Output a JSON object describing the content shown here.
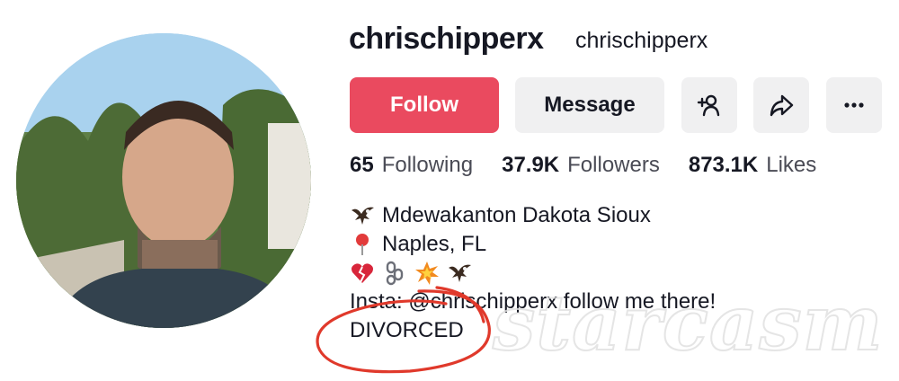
{
  "profile": {
    "username": "chrischipperx",
    "nickname": "chrischipperx"
  },
  "actions": {
    "follow_label": "Follow",
    "message_label": "Message",
    "add_friend_icon": "add-user-icon",
    "share_icon": "share-icon",
    "more_icon": "more-icon"
  },
  "stats": [
    {
      "value": "65",
      "label": "Following"
    },
    {
      "value": "37.9K",
      "label": "Followers"
    },
    {
      "value": "873.1K",
      "label": "Likes"
    }
  ],
  "bio": {
    "line1": "Mdewakanton Dakota Sioux",
    "line2": "Naples, FL",
    "line4": "Insta: @chrischipperx follow me there!",
    "line5": "DIVORCED"
  },
  "watermark": "starcasm",
  "colors": {
    "follow_button": "#ea4a5f",
    "annotation_circle": "#e0392b"
  }
}
